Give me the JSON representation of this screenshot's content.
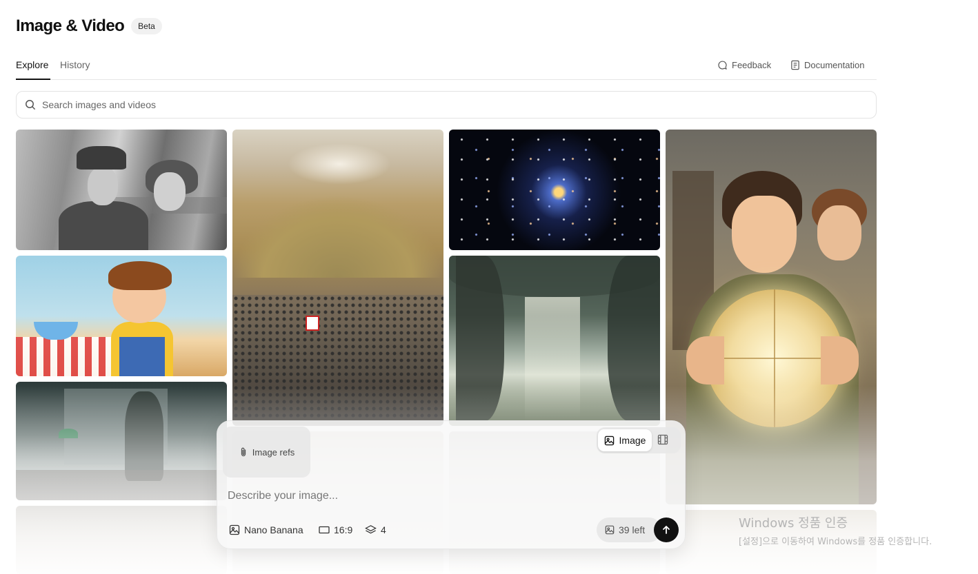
{
  "header": {
    "title": "Image & Video",
    "badge": "Beta"
  },
  "tabs": [
    {
      "label": "Explore",
      "active": true
    },
    {
      "label": "History",
      "active": false
    }
  ],
  "top_links": {
    "feedback": "Feedback",
    "documentation": "Documentation"
  },
  "search": {
    "placeholder": "Search images and videos",
    "value": ""
  },
  "gallery": [
    {
      "name": "vintage-couple",
      "icon": "photo"
    },
    {
      "name": "kid-banana",
      "icon": "photo"
    },
    {
      "name": "detective-office",
      "icon": "photo"
    },
    {
      "name": "crusader-battle",
      "icon": "photo"
    },
    {
      "name": "galaxy-field",
      "icon": "photo"
    },
    {
      "name": "forest-cathedral",
      "icon": "photo"
    },
    {
      "name": "boy-glowing-map",
      "icon": "photo"
    }
  ],
  "composer": {
    "refs_label": "Image refs",
    "mode_image_label": "Image",
    "mode_video_icon": "film-icon",
    "prompt_placeholder": "Describe your image...",
    "model_label": "Nano Banana",
    "aspect_label": "16:9",
    "count_label": "4",
    "credits_label": "39 left"
  },
  "watermark": {
    "title": "Windows 정품 인증",
    "subtitle": "[설정]으로 이동하여 Windows를 정품 인증합니다."
  },
  "colors": {
    "text": "#111111",
    "muted": "#666666",
    "border": "#e3e3e3",
    "send": "#111111"
  }
}
